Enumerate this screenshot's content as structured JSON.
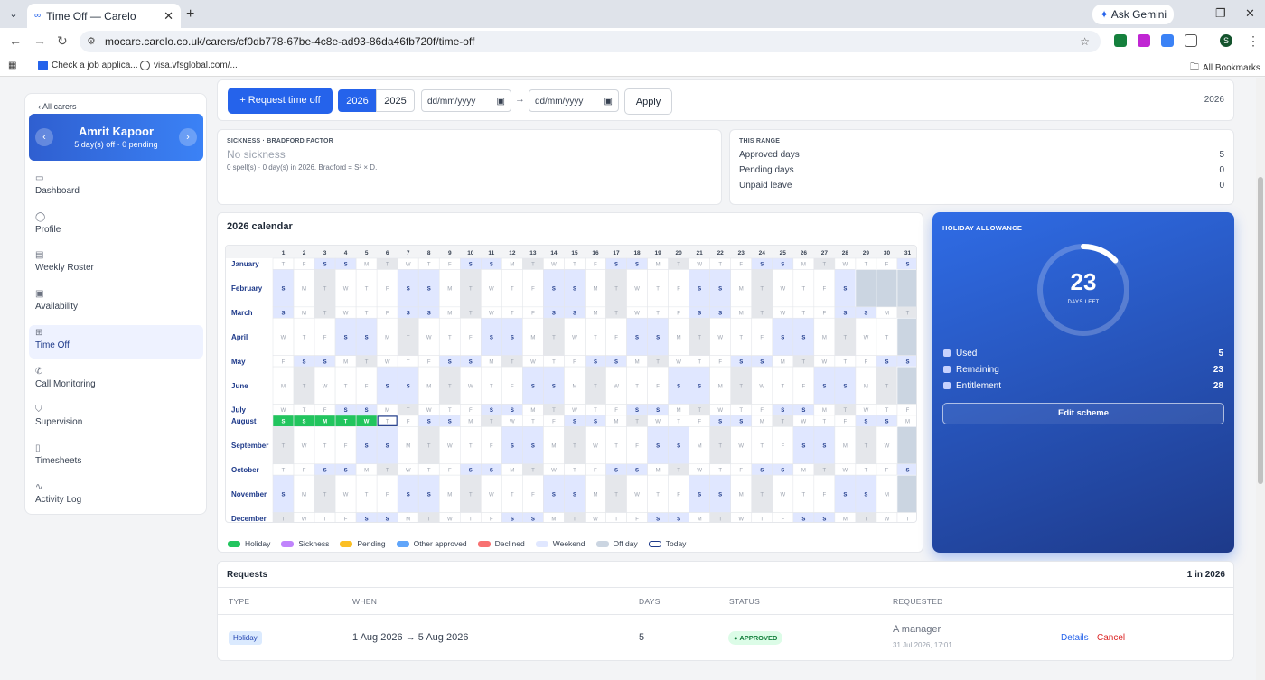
{
  "browser": {
    "tab_title": "Time Off — Carelo",
    "url": "mocare.carelo.co.uk/carers/cf0db778-67be-4c8e-ad93-86da46fb720f/time-off",
    "ask_gemini": "Ask Gemini",
    "bookmarks": [
      "Check a job applica...",
      "visa.vfsglobal.com/..."
    ],
    "all_bookmarks": "All Bookmarks",
    "profile_initial": "S"
  },
  "sidebar": {
    "back": "‹ All carers",
    "carer_name": "Amrit Kapoor",
    "carer_sub": "5 day(s) off · 0 pending",
    "items": [
      {
        "label": "Dashboard",
        "icon": "calendar-icon"
      },
      {
        "label": "Profile",
        "icon": "user-icon"
      },
      {
        "label": "Weekly Roster",
        "icon": "roster-icon"
      },
      {
        "label": "Availability",
        "icon": "calendar-check-icon"
      },
      {
        "label": "Time Off",
        "icon": "calendar-plus-icon"
      },
      {
        "label": "Call Monitoring",
        "icon": "phone-icon"
      },
      {
        "label": "Supervision",
        "icon": "shield-icon"
      },
      {
        "label": "Timesheets",
        "icon": "document-icon"
      },
      {
        "label": "Activity Log",
        "icon": "activity-icon"
      }
    ]
  },
  "toolbar": {
    "request_button": "+ Request time off",
    "years": [
      "2026",
      "2025"
    ],
    "date_from_placeholder": "dd/mm/yyyy",
    "date_to_placeholder": "dd/mm/yyyy",
    "arrow": "→",
    "apply": "Apply",
    "year_label": "2026"
  },
  "sickness": {
    "label": "SICKNESS · BRADFORD FACTOR",
    "title": "No sickness",
    "detail": "0 spell(s) · 0 day(s) in 2026. Bradford = S² × D."
  },
  "range": {
    "label": "THIS RANGE",
    "rows": [
      {
        "label": "Approved days",
        "value": "5"
      },
      {
        "label": "Pending days",
        "value": "0"
      },
      {
        "label": "Unpaid leave",
        "value": "0"
      }
    ]
  },
  "calendar": {
    "title": "2026 calendar",
    "year": 2026,
    "months": [
      "January",
      "February",
      "March",
      "April",
      "May",
      "June",
      "July",
      "August",
      "September",
      "October",
      "November",
      "December"
    ],
    "day_letters": [
      "S",
      "M",
      "T",
      "W",
      "T",
      "F",
      "S"
    ],
    "holiday_start": "2026-08-01",
    "holiday_end": "2026-08-05",
    "today": "2026-08-06",
    "legend": [
      {
        "label": "Holiday",
        "color": "#22c55e"
      },
      {
        "label": "Sickness",
        "color": "#c084fc"
      },
      {
        "label": "Pending",
        "color": "#fbbf24"
      },
      {
        "label": "Other approved",
        "color": "#60a5fa"
      },
      {
        "label": "Declined",
        "color": "#f87171"
      },
      {
        "label": "Weekend",
        "color": "#e0e7ff"
      },
      {
        "label": "Off day",
        "color": "#cbd5e1"
      },
      {
        "label": "Today",
        "color": "#1e3a8a"
      }
    ]
  },
  "allowance": {
    "label": "HOLIDAY ALLOWANCE",
    "days_left": "23",
    "days_left_label": "DAYS LEFT",
    "remaining_fraction": 0.8214,
    "rows": [
      {
        "label": "Used",
        "value": "5"
      },
      {
        "label": "Remaining",
        "value": "23"
      },
      {
        "label": "Entitlement",
        "value": "28"
      }
    ],
    "edit_button": "Edit scheme"
  },
  "requests": {
    "title": "Requests",
    "count": "1 in 2026",
    "headers": [
      "TYPE",
      "WHEN",
      "DAYS",
      "STATUS",
      "REQUESTED"
    ],
    "row": {
      "type": "Holiday",
      "when": "1 Aug 2026 → 5 Aug 2026",
      "days": "5",
      "status": "● APPROVED",
      "requested_by": "A manager",
      "requested_at": "31 Jul 2026, 17:01",
      "details": "Details",
      "cancel": "Cancel"
    }
  }
}
